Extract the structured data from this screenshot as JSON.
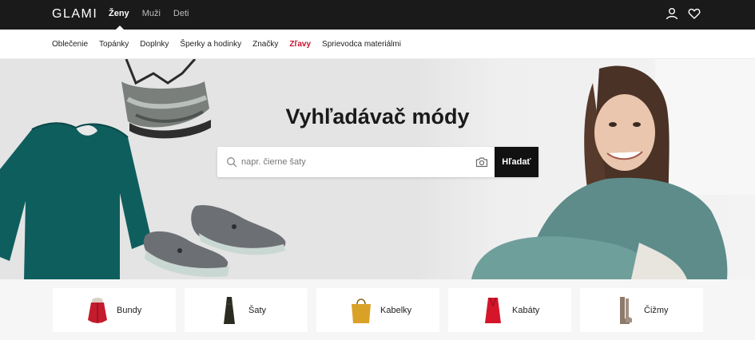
{
  "header": {
    "logo": "GLAMI",
    "gender_tabs": [
      {
        "label": "Ženy",
        "active": true
      },
      {
        "label": "Muži",
        "active": false
      },
      {
        "label": "Deti",
        "active": false
      }
    ],
    "icons": [
      "user-icon",
      "heart-icon"
    ]
  },
  "category_nav": {
    "items": [
      "Oblečenie",
      "Topánky",
      "Doplnky",
      "Šperky a hodinky",
      "Značky",
      "Zľavy",
      "Sprievodca materiálmi"
    ],
    "sale_color": "#c8102e"
  },
  "hero": {
    "title": "Vyhľadávač módy",
    "search": {
      "placeholder": "napr. čierne šaty",
      "button_label": "Hľadať"
    }
  },
  "categories": [
    {
      "label": "Bundy",
      "icon": "red-jacket"
    },
    {
      "label": "Šaty",
      "icon": "dark-dress"
    },
    {
      "label": "Kabelky",
      "icon": "mustard-handbag"
    },
    {
      "label": "Kabáty",
      "icon": "red-coat"
    },
    {
      "label": "Čižmy",
      "icon": "tan-boots"
    }
  ],
  "colors": {
    "topbar": "#1a1a1a",
    "hero_bg": "#e4e4e4",
    "sweater": "#0f5e5e",
    "sale": "#c8102e"
  }
}
